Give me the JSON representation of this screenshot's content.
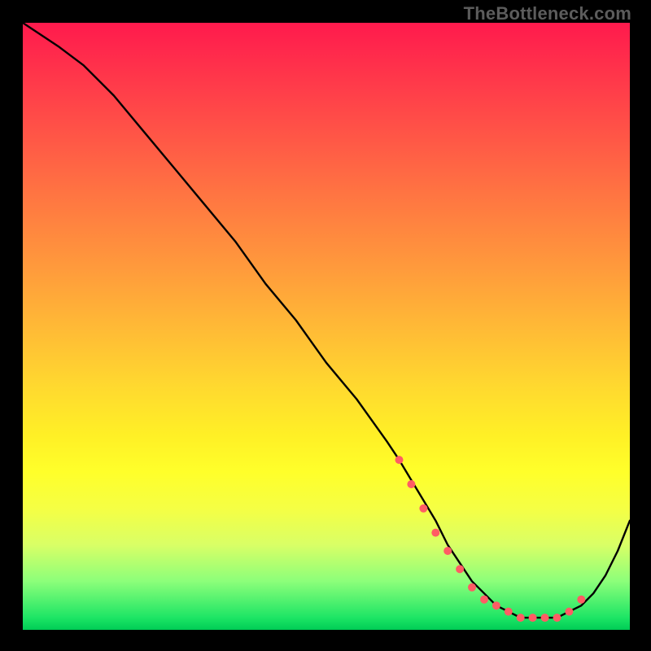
{
  "watermark": "TheBottleneck.com",
  "colors": {
    "frame": "#000000",
    "gradient_top": "#ff1a4d",
    "gradient_mid": "#ffff2a",
    "gradient_bottom": "#00cc55",
    "curve": "#000000",
    "marker_fill": "#ff5c64",
    "marker_stroke": "#ff5c64"
  },
  "chart_data": {
    "type": "line",
    "title": "",
    "xlabel": "",
    "ylabel": "",
    "xlim": [
      0,
      100
    ],
    "ylim": [
      0,
      100
    ],
    "grid": false,
    "legend": false,
    "series_name": "bottleneck-curve",
    "x": [
      0,
      3,
      6,
      10,
      15,
      20,
      25,
      30,
      35,
      40,
      45,
      50,
      55,
      60,
      62,
      65,
      68,
      70,
      72,
      74,
      76,
      78,
      80,
      82,
      84,
      86,
      88,
      90,
      92,
      94,
      96,
      98,
      100
    ],
    "y": [
      100,
      98,
      96,
      93,
      88,
      82,
      76,
      70,
      64,
      57,
      51,
      44,
      38,
      31,
      28,
      23,
      18,
      14,
      11,
      8,
      6,
      4,
      3,
      2,
      2,
      2,
      2,
      3,
      4,
      6,
      9,
      13,
      18
    ],
    "markers": {
      "comment": "highlighted marker cluster near the basin of the curve",
      "x": [
        62,
        64,
        66,
        68,
        70,
        72,
        74,
        76,
        78,
        80,
        82,
        84,
        86,
        88,
        90,
        92
      ],
      "y": [
        28,
        24,
        20,
        16,
        13,
        10,
        7,
        5,
        4,
        3,
        2,
        2,
        2,
        2,
        3,
        5
      ]
    }
  }
}
